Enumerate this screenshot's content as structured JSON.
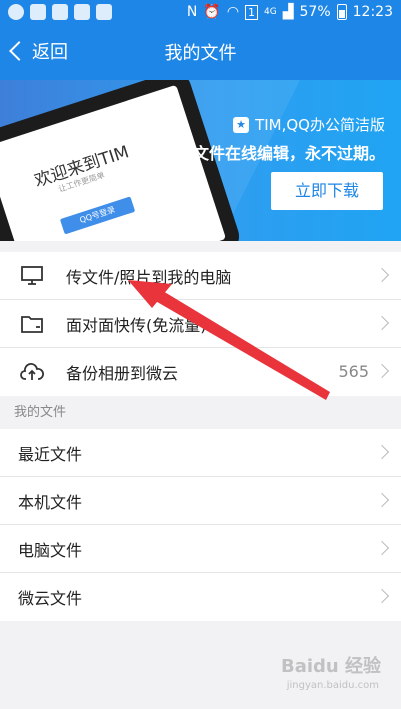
{
  "statusbar": {
    "left_icons": [
      "add-icon",
      "photo-icon",
      "app-icon",
      "app-icon",
      "app-icon"
    ],
    "right_text": [
      "N",
      "4G",
      "57%",
      "12:23"
    ],
    "sim_label": "1"
  },
  "navbar": {
    "back_label": "返回",
    "title": "我的文件"
  },
  "banner": {
    "brand": "TIM,QQ办公简洁版",
    "slogan": "文件在线编辑，永不过期。",
    "download_label": "立即下载",
    "phone_title": "欢迎来到TIM",
    "phone_sub": "让工作更简单",
    "phone_button": "QQ号登录"
  },
  "top_list": [
    {
      "label": "传文件/照片到我的电脑",
      "icon": "monitor-icon"
    },
    {
      "label": "面对面快传(免流量)",
      "icon": "folder-icon"
    },
    {
      "label": "备份相册到微云",
      "icon": "cloud-upload-icon",
      "count": "565"
    }
  ],
  "section": {
    "header": "我的文件"
  },
  "file_list": [
    {
      "label": "最近文件"
    },
    {
      "label": "本机文件"
    },
    {
      "label": "电脑文件"
    },
    {
      "label": "微云文件"
    }
  ],
  "watermark": {
    "text": "Baidu 经验",
    "sub": "jingyan.baidu.com"
  },
  "colors": {
    "accent": "#1e86e6",
    "annotation": "#e8343a"
  }
}
